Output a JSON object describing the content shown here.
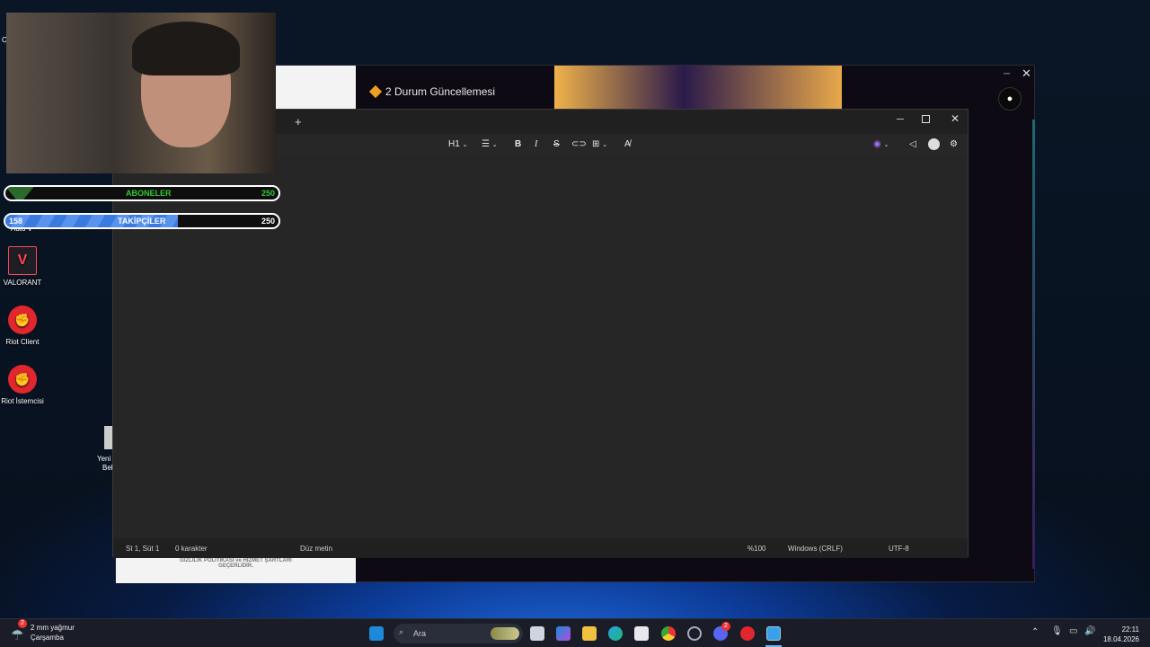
{
  "desktop": {
    "icons": [
      {
        "label": "VALORANT"
      },
      {
        "label": "Riot Client"
      },
      {
        "label": "Riot İstemcisi"
      }
    ],
    "partial_labels": [
      "C",
      "Auto V",
      "Yeni",
      "Bel"
    ]
  },
  "overlay": {
    "subs_label": "ABONELER",
    "subs_goal": "250",
    "followers_label": "TAKİPÇİLER",
    "followers_current": "158",
    "followers_goal": "250",
    "followers_progress": 0.632
  },
  "back_app": {
    "notice": "2 Durum Güncellemesi",
    "footer_text_1": "GİZLİLİK POLİTİKASI ve HİZMET ŞARTLARI",
    "footer_text_2": "GEÇERLİDİR."
  },
  "notepad": {
    "heading_btn": "H1",
    "new_tab": "+",
    "status": {
      "position": "St 1, Süt 1",
      "chars": "0 karakter",
      "format": "Düz metin",
      "zoom": "%100",
      "line_ending": "Windows (CRLF)",
      "encoding": "UTF-8"
    }
  },
  "taskbar": {
    "weather_temp": "2 mm yağmur",
    "weather_day": "Çarşamba",
    "weather_badge": "2",
    "search": "Ara",
    "discord_badge": "2",
    "time": "22:11",
    "date": "18.04.2026"
  },
  "colors": {
    "accent": "#1c8ad8",
    "subs_green": "#32c832",
    "followers_blue": "#3b7be0"
  }
}
